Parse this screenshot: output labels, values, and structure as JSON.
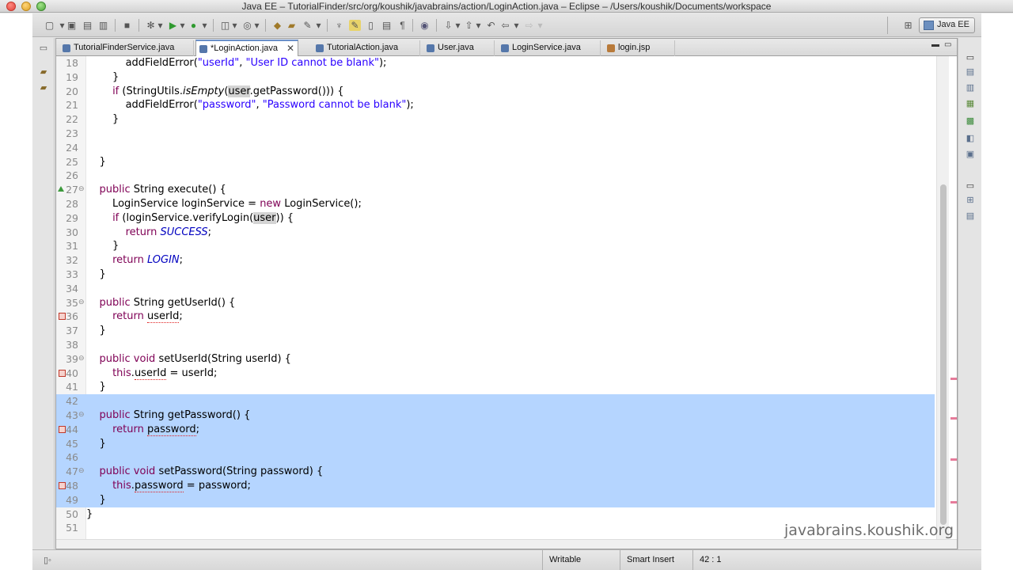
{
  "window": {
    "title": "Java EE – TutorialFinder/src/org/koushik/javabrains/action/LoginAction.java – Eclipse – /Users/koushik/Documents/workspace"
  },
  "toolbar": {
    "perspective_label": "Java EE"
  },
  "tabs": [
    {
      "label": "TutorialFinderService.java",
      "active": false
    },
    {
      "label": "*LoginAction.java",
      "active": true
    },
    {
      "label": "TutorialAction.java",
      "active": false
    },
    {
      "label": "User.java",
      "active": false
    },
    {
      "label": "LoginService.java",
      "active": false
    },
    {
      "label": "login.jsp",
      "active": false
    }
  ],
  "editor": {
    "lines": [
      {
        "num": "18",
        "parts": [
          [
            "",
            "            addFieldError("
          ],
          [
            "str",
            "\"userId\""
          ],
          [
            "",
            ", "
          ],
          [
            "str",
            "\"User ID cannot be blank\""
          ],
          [
            "",
            ");"
          ]
        ]
      },
      {
        "num": "19",
        "parts": [
          [
            "",
            "        }"
          ]
        ]
      },
      {
        "num": "20",
        "parts": [
          [
            "",
            "        "
          ],
          [
            "kw",
            "if"
          ],
          [
            "",
            " (StringUtils."
          ],
          [
            "ital",
            "isEmpty"
          ],
          [
            "",
            "("
          ],
          [
            "occ",
            "user"
          ],
          [
            "",
            ".getPassword())) {"
          ]
        ]
      },
      {
        "num": "21",
        "parts": [
          [
            "",
            "            addFieldError("
          ],
          [
            "str",
            "\"password\""
          ],
          [
            "",
            ", "
          ],
          [
            "str",
            "\"Password cannot be blank\""
          ],
          [
            "",
            ");"
          ]
        ]
      },
      {
        "num": "22",
        "parts": [
          [
            "",
            "        }"
          ]
        ]
      },
      {
        "num": "23",
        "parts": [
          [
            "",
            ""
          ]
        ]
      },
      {
        "num": "24",
        "parts": [
          [
            "",
            ""
          ]
        ]
      },
      {
        "num": "25",
        "parts": [
          [
            "",
            "    }"
          ]
        ]
      },
      {
        "num": "26",
        "parts": [
          [
            "",
            ""
          ]
        ]
      },
      {
        "num": "27",
        "parts": [
          [
            "",
            "    "
          ],
          [
            "kw",
            "public"
          ],
          [
            "",
            " String execute() {"
          ]
        ]
      },
      {
        "num": "28",
        "parts": [
          [
            "",
            "        LoginService loginService = "
          ],
          [
            "kw",
            "new"
          ],
          [
            "",
            " LoginService();"
          ]
        ]
      },
      {
        "num": "29",
        "parts": [
          [
            "",
            "        "
          ],
          [
            "kw",
            "if"
          ],
          [
            "",
            " (loginService.verifyLogin("
          ],
          [
            "occ",
            "user"
          ],
          [
            "",
            ")) {"
          ]
        ]
      },
      {
        "num": "30",
        "parts": [
          [
            "",
            "            "
          ],
          [
            "kw",
            "return"
          ],
          [
            "",
            " "
          ],
          [
            "cst",
            "SUCCESS"
          ],
          [
            "",
            ";"
          ]
        ]
      },
      {
        "num": "31",
        "parts": [
          [
            "",
            "        }"
          ]
        ]
      },
      {
        "num": "32",
        "parts": [
          [
            "",
            "        "
          ],
          [
            "kw",
            "return"
          ],
          [
            "",
            " "
          ],
          [
            "cst",
            "LOGIN"
          ],
          [
            "",
            ";"
          ]
        ]
      },
      {
        "num": "33",
        "parts": [
          [
            "",
            "    }"
          ]
        ]
      },
      {
        "num": "34",
        "parts": [
          [
            "",
            ""
          ]
        ]
      },
      {
        "num": "35",
        "parts": [
          [
            "",
            "    "
          ],
          [
            "kw",
            "public"
          ],
          [
            "",
            " String getUserId() {"
          ]
        ]
      },
      {
        "num": "36",
        "parts": [
          [
            "",
            "        "
          ],
          [
            "kw",
            "return"
          ],
          [
            "",
            " "
          ],
          [
            "err",
            "userId"
          ],
          [
            "",
            ";"
          ]
        ]
      },
      {
        "num": "37",
        "parts": [
          [
            "",
            "    }"
          ]
        ]
      },
      {
        "num": "38",
        "parts": [
          [
            "",
            ""
          ]
        ]
      },
      {
        "num": "39",
        "parts": [
          [
            "",
            "    "
          ],
          [
            "kw",
            "public"
          ],
          [
            "",
            " "
          ],
          [
            "kw",
            "void"
          ],
          [
            "",
            " setUserId(String userId) {"
          ]
        ]
      },
      {
        "num": "40",
        "parts": [
          [
            "",
            "        "
          ],
          [
            "kw",
            "this"
          ],
          [
            "",
            "."
          ],
          [
            "err",
            "userId"
          ],
          [
            "",
            " = userId;"
          ]
        ]
      },
      {
        "num": "41",
        "parts": [
          [
            "",
            "    }"
          ]
        ]
      },
      {
        "num": "42",
        "parts": [
          [
            "",
            ""
          ]
        ]
      },
      {
        "num": "43",
        "parts": [
          [
            "",
            "    "
          ],
          [
            "kw",
            "public"
          ],
          [
            "",
            " String getPassword() {"
          ]
        ]
      },
      {
        "num": "44",
        "parts": [
          [
            "",
            "        "
          ],
          [
            "kw",
            "return"
          ],
          [
            "",
            " "
          ],
          [
            "err",
            "password"
          ],
          [
            "",
            ";"
          ]
        ]
      },
      {
        "num": "45",
        "parts": [
          [
            "",
            "    }"
          ]
        ]
      },
      {
        "num": "46",
        "parts": [
          [
            "",
            ""
          ]
        ]
      },
      {
        "num": "47",
        "parts": [
          [
            "",
            "    "
          ],
          [
            "kw",
            "public"
          ],
          [
            "",
            " "
          ],
          [
            "kw",
            "void"
          ],
          [
            "",
            " setPassword(String password) {"
          ]
        ]
      },
      {
        "num": "48",
        "parts": [
          [
            "",
            "        "
          ],
          [
            "kw",
            "this"
          ],
          [
            "",
            "."
          ],
          [
            "err",
            "password"
          ],
          [
            "",
            " = password;"
          ]
        ]
      },
      {
        "num": "49",
        "parts": [
          [
            "",
            "    }"
          ]
        ]
      },
      {
        "num": "50",
        "parts": [
          [
            "",
            "}"
          ]
        ]
      },
      {
        "num": "51",
        "parts": [
          [
            "",
            ""
          ]
        ]
      }
    ],
    "fold_lines": [
      "27",
      "35",
      "39",
      "43",
      "47"
    ],
    "override_marker_lines": [
      "27"
    ],
    "error_marker_lines": [
      "36",
      "40",
      "44",
      "48"
    ],
    "selected_lines": [
      "42",
      "43",
      "44",
      "45",
      "46",
      "47",
      "48",
      "49"
    ],
    "watermark": "javabrains.koushik.org"
  },
  "status": {
    "mode": "Writable",
    "insert": "Smart Insert",
    "position": "42 : 1"
  },
  "colors": {
    "keyword": "#7f0055",
    "string": "#2a00ff",
    "constant": "#0000c0",
    "selection": "#b5d5ff"
  }
}
